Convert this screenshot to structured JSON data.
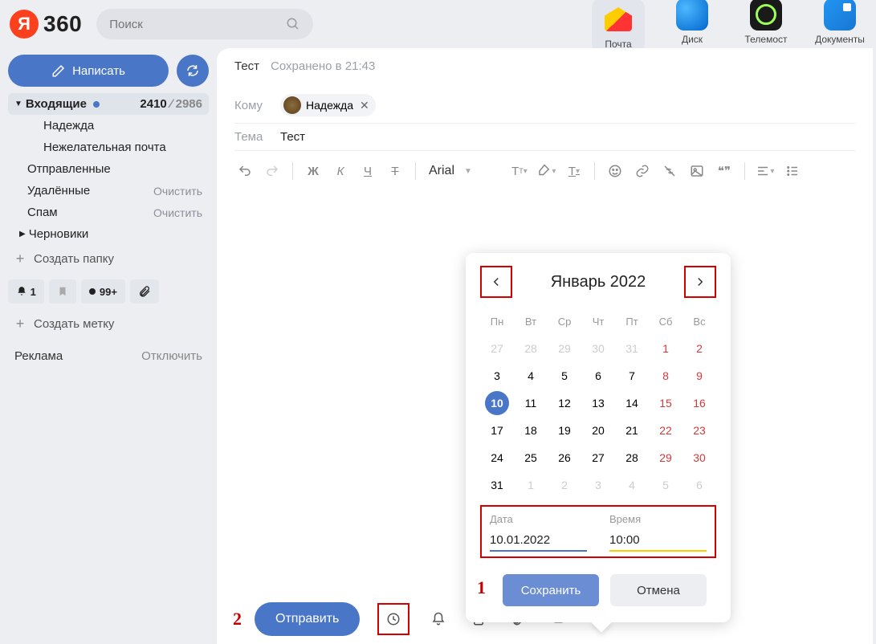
{
  "logo_text": "360",
  "search": {
    "placeholder": "Поиск"
  },
  "apps": {
    "mail": "Почта",
    "disk": "Диск",
    "telemost": "Телемост",
    "docs": "Документы"
  },
  "sidebar": {
    "compose": "Написать",
    "inbox": {
      "label": "Входящие",
      "unread": "2410",
      "total": "2986"
    },
    "sub_nadezhda": "Надежда",
    "sub_junk": "Нежелательная почта",
    "sent": "Отправленные",
    "deleted": "Удалённые",
    "spam": "Спам",
    "drafts": "Черновики",
    "clear": "Очистить",
    "create_folder": "Создать папку",
    "create_label": "Создать метку",
    "tag_bell": "1",
    "tag_count": "99+",
    "ad": "Реклама",
    "ad_off": "Отключить"
  },
  "compose": {
    "title": "Тест",
    "saved": "Сохранено в 21:43",
    "to_label": "Кому",
    "recipient": "Надежда",
    "subject_label": "Тема",
    "subject_value": "Тест",
    "font_name": "Arial"
  },
  "datepicker": {
    "month": "Январь 2022",
    "weekdays": [
      "Пн",
      "Вт",
      "Ср",
      "Чт",
      "Пт",
      "Сб",
      "Вс"
    ],
    "rows": [
      [
        {
          "d": "27",
          "m": true
        },
        {
          "d": "28",
          "m": true
        },
        {
          "d": "29",
          "m": true
        },
        {
          "d": "30",
          "m": true
        },
        {
          "d": "31",
          "m": true
        },
        {
          "d": "1",
          "w": true
        },
        {
          "d": "2",
          "w": true
        }
      ],
      [
        {
          "d": "3"
        },
        {
          "d": "4"
        },
        {
          "d": "5"
        },
        {
          "d": "6"
        },
        {
          "d": "7"
        },
        {
          "d": "8",
          "w": true
        },
        {
          "d": "9",
          "w": true
        }
      ],
      [
        {
          "d": "10",
          "sel": true
        },
        {
          "d": "11"
        },
        {
          "d": "12"
        },
        {
          "d": "13"
        },
        {
          "d": "14"
        },
        {
          "d": "15",
          "w": true
        },
        {
          "d": "16",
          "w": true
        }
      ],
      [
        {
          "d": "17"
        },
        {
          "d": "18"
        },
        {
          "d": "19"
        },
        {
          "d": "20"
        },
        {
          "d": "21"
        },
        {
          "d": "22",
          "w": true
        },
        {
          "d": "23",
          "w": true
        }
      ],
      [
        {
          "d": "24"
        },
        {
          "d": "25"
        },
        {
          "d": "26"
        },
        {
          "d": "27"
        },
        {
          "d": "28"
        },
        {
          "d": "29",
          "w": true
        },
        {
          "d": "30",
          "w": true
        }
      ],
      [
        {
          "d": "31"
        },
        {
          "d": "1",
          "m": true
        },
        {
          "d": "2",
          "m": true
        },
        {
          "d": "3",
          "m": true
        },
        {
          "d": "4",
          "m": true
        },
        {
          "d": "5",
          "m": true
        },
        {
          "d": "6",
          "m": true
        }
      ]
    ],
    "date_label": "Дата",
    "time_label": "Время",
    "date_value": "10.01.2022",
    "time_value": "10:00",
    "save": "Сохранить",
    "cancel": "Отмена"
  },
  "bottom": {
    "send": "Отправить"
  },
  "annotations": {
    "one": "1",
    "two": "2"
  }
}
